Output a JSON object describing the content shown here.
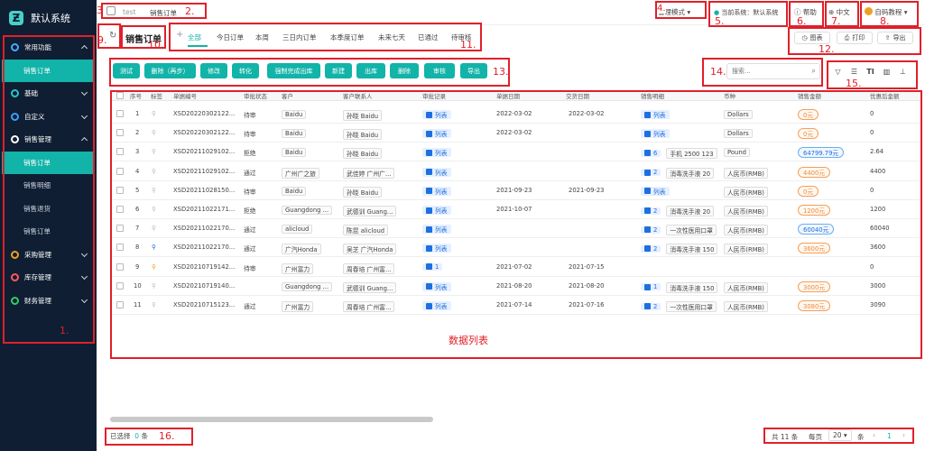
{
  "app": {
    "title": "默认系统"
  },
  "sidebar": {
    "items": [
      {
        "label": "常用功能",
        "kind": "group",
        "icon": "star-icon",
        "icon_color": "#4aa8ff",
        "expanded": true
      },
      {
        "label": "销售订单",
        "kind": "sub",
        "active": true
      },
      {
        "label": "基础",
        "kind": "group",
        "icon": "circle-icon",
        "icon_color": "#27c6c6",
        "expanded": false
      },
      {
        "label": "自定义",
        "kind": "group",
        "icon": "circle-icon",
        "icon_color": "#3aa0ff",
        "expanded": false
      },
      {
        "label": "销售管理",
        "kind": "group",
        "icon": "yen-icon",
        "icon_color": "#ffffff",
        "expanded": true
      },
      {
        "label": "销售订单",
        "kind": "sub",
        "active": true
      },
      {
        "label": "销售明细",
        "kind": "sub"
      },
      {
        "label": "销售退货",
        "kind": "sub"
      },
      {
        "label": "销售订单",
        "kind": "sub"
      },
      {
        "label": "采购管理",
        "kind": "group",
        "icon": "circle-icon",
        "icon_color": "#f0a020",
        "expanded": false
      },
      {
        "label": "库存管理",
        "kind": "group",
        "icon": "circle-icon",
        "icon_color": "#ff5a5a",
        "expanded": false
      },
      {
        "label": "财务管理",
        "kind": "group",
        "icon": "circle-icon",
        "icon_color": "#33cc66",
        "expanded": false
      }
    ]
  },
  "header": {
    "breadcrumb": [
      "test",
      "销售订单"
    ],
    "mode": "管理模式",
    "current_system": "当前系统：默认系统",
    "help": "帮助",
    "language": "中文",
    "user": "自码教程"
  },
  "page": {
    "title": "销售订单"
  },
  "tabs": [
    "全部",
    "今日订单",
    "本周",
    "三日内订单",
    "本季度订单",
    "未来七天",
    "已通过",
    "待审核"
  ],
  "tools": {
    "chart": "图表",
    "print": "打印",
    "export": "导出"
  },
  "actions": [
    "测试",
    "删除（再步）",
    "修改",
    "转化",
    "强制完成出库",
    "新建",
    "出库",
    "删除",
    "审核",
    "导出"
  ],
  "search": {
    "placeholder": "搜索..."
  },
  "table": {
    "columns": [
      "序号",
      "标签",
      "单据编号",
      "审批状态",
      "客户",
      "客户联系人",
      "审批记录",
      "单据日期",
      "交货日期",
      "销售明细",
      "币种",
      "销售金额",
      "优惠后金额"
    ],
    "rows": [
      {
        "no": "1",
        "code": "XSD20220302122...",
        "status": "待审",
        "customer": "Baidu",
        "contact": "孙晓 Baidu",
        "record": "列表",
        "date": "2022-03-02",
        "delivery": "2022-03-02",
        "detail": "列表",
        "detail_count": "",
        "product": "",
        "currency": "Dollars",
        "amount": "0元",
        "amount_style": "orange",
        "discount": "0"
      },
      {
        "no": "2",
        "code": "XSD20220302122...",
        "status": "待审",
        "customer": "Baidu",
        "contact": "孙晓 Baidu",
        "record": "列表",
        "date": "2022-03-02",
        "delivery": "",
        "detail": "列表",
        "detail_count": "",
        "product": "",
        "currency": "Dollars",
        "amount": "0元",
        "amount_style": "orange",
        "discount": "0"
      },
      {
        "no": "3",
        "code": "XSD20211029102...",
        "status": "拒绝",
        "customer": "Baidu",
        "contact": "孙晓 Baidu",
        "record": "列表",
        "date": "",
        "delivery": "",
        "detail": "",
        "detail_count": "6",
        "product": "手机 2500 123",
        "currency": "Pound",
        "amount": "64799.79元",
        "amount_style": "blue",
        "discount": "2.64"
      },
      {
        "no": "4",
        "code": "XSD20211029102...",
        "status": "通过",
        "customer": "广州广之旅",
        "contact": "武佳婷 广州广...",
        "record": "列表",
        "date": "",
        "delivery": "",
        "detail": "",
        "detail_count": "2",
        "product": "消毒洗手液 20",
        "currency": "人民币(RMB)",
        "amount": "4400元",
        "amount_style": "orange",
        "discount": "4400"
      },
      {
        "no": "5",
        "code": "XSD20211028150...",
        "status": "待审",
        "customer": "Baidu",
        "contact": "孙晓 Baidu",
        "record": "列表",
        "date": "2021-09-23",
        "delivery": "2021-09-23",
        "detail": "列表",
        "detail_count": "",
        "product": "",
        "currency": "人民币(RMB)",
        "amount": "0元",
        "amount_style": "orange",
        "discount": "0"
      },
      {
        "no": "6",
        "code": "XSD20211022171...",
        "status": "拒绝",
        "customer": "Guangdong ...",
        "contact": "武德训 Guang...",
        "record": "列表",
        "date": "2021-10-07",
        "delivery": "",
        "detail": "",
        "detail_count": "2",
        "product": "消毒洗手液 20",
        "currency": "人民币(RMB)",
        "amount": "1200元",
        "amount_style": "orange",
        "discount": "1200"
      },
      {
        "no": "7",
        "code": "XSD20211022170...",
        "status": "通过",
        "customer": "alicloud",
        "contact": "陈昆 alicloud",
        "record": "列表",
        "date": "",
        "delivery": "",
        "detail": "",
        "detail_count": "2",
        "product": "一次性医用口罩",
        "currency": "人民币(RMB)",
        "amount": "60040元",
        "amount_style": "blue",
        "discount": "60040"
      },
      {
        "no": "8",
        "code": "XSD20211022170...",
        "status": "通过",
        "customer": "广汽Honda",
        "contact": "吴芝 广汽Honda",
        "record": "列表",
        "date": "",
        "delivery": "",
        "detail": "",
        "detail_count": "2",
        "product": "消毒洗手液 150",
        "currency": "人民币(RMB)",
        "amount": "3600元",
        "amount_style": "orange",
        "discount": "3600"
      },
      {
        "no": "9",
        "code": "XSD20210719142...",
        "status": "待审",
        "customer": "广州富力",
        "contact": "周春培 广州富...",
        "record": "",
        "record_count": "1",
        "date": "2021-07-02",
        "delivery": "2021-07-15",
        "detail": "",
        "detail_count": "",
        "product": "",
        "currency": "",
        "amount": "",
        "amount_style": "",
        "discount": "0"
      },
      {
        "no": "10",
        "code": "XSD20210719140...",
        "status": "",
        "customer": "Guangdong ...",
        "contact": "武德训 Guang...",
        "record": "列表",
        "date": "2021-08-20",
        "delivery": "2021-08-20",
        "detail": "",
        "detail_count": "1",
        "product": "消毒洗手液 150",
        "currency": "人民币(RMB)",
        "amount": "3000元",
        "amount_style": "orange",
        "discount": "3000"
      },
      {
        "no": "11",
        "code": "XSD20210715123...",
        "status": "通过",
        "customer": "广州富力",
        "contact": "周春培 广州富...",
        "record": "列表",
        "date": "2021-07-14",
        "delivery": "2021-07-16",
        "detail": "",
        "detail_count": "2",
        "product": "一次性医用口罩",
        "currency": "人民币(RMB)",
        "amount": "3080元",
        "amount_style": "orange",
        "discount": "3090"
      }
    ]
  },
  "center_label": "数据列表",
  "footer": {
    "selected": "已选择",
    "selected_count": "0",
    "selected_unit": "条",
    "total": "共 11 条",
    "per_page": "每页",
    "page_size": "20",
    "unit": "条",
    "page": "1"
  },
  "markers": [
    "1.",
    "2.",
    "3",
    "4.",
    "5.",
    "6.",
    "7.",
    "8.",
    "9.",
    "10.",
    "11.",
    "12.",
    "13.",
    "14.",
    "15.",
    "16."
  ],
  "colors": {
    "accent": "#12b3a8",
    "sidebar": "#0f1e33",
    "annotation": "#e0202a"
  }
}
